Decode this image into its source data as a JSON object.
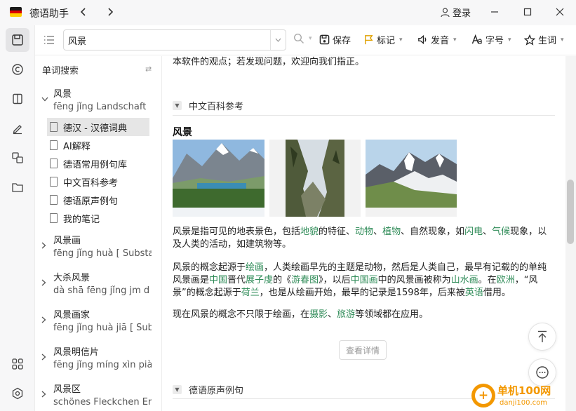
{
  "app": {
    "title": "德语助手",
    "login": "登录"
  },
  "colors": {
    "accent": "#2e8b57",
    "watermark": "#f39800",
    "flag_black": "#1a1a1a",
    "flag_red": "#dd0000",
    "flag_gold": "#ffce00"
  },
  "toolbar": {
    "search_value": "风景",
    "save": "保存",
    "bookmark": "标记",
    "pronounce": "发音",
    "font": "字号",
    "newword": "生词"
  },
  "sidebar": {
    "header": "单词搜索",
    "entries": [
      {
        "word": "风景",
        "pinyin": "fēng jǐng    Landschaft"
      },
      {
        "word": "风景画",
        "pinyin": "fēng jǐng huà   [ Substa"
      },
      {
        "word": "大杀风景",
        "pinyin": "dà shā fēng jǐng    jm d"
      },
      {
        "word": "风景画家",
        "pinyin": "fēng jǐng huà jiā   [ Sub"
      },
      {
        "word": "风景明信片",
        "pinyin": "fēng jǐng míng xìn piàn"
      },
      {
        "word": "风景区",
        "pinyin": "schönes Fleckchen Erde"
      }
    ],
    "subitems": [
      "德汉 - 汉德词典",
      "AI解释",
      "德语常用例句库",
      "中文百科参考",
      "德语原声例句",
      "我的笔记"
    ]
  },
  "main": {
    "top_text": "本软件的观点；若发现问题，欢迎向我们指正。",
    "section1": "中文百科参考",
    "entry_title": "风景",
    "p1": [
      {
        "t": "风景是指可见的地表景色，包括"
      },
      {
        "t": "地貌",
        "g": 1
      },
      {
        "t": "的特征、"
      },
      {
        "t": "动物",
        "g": 1
      },
      {
        "t": "、"
      },
      {
        "t": "植物",
        "g": 1
      },
      {
        "t": "、自然现象，如"
      },
      {
        "t": "闪电",
        "g": 1
      },
      {
        "t": "、"
      },
      {
        "t": "气候",
        "g": 1
      },
      {
        "t": "现象，以及人类的活动，如建筑物等。"
      }
    ],
    "p2": [
      {
        "t": "风景的概念起源于"
      },
      {
        "t": "绘画",
        "g": 1
      },
      {
        "t": "，人类绘画早先的主题是动物，然后是人类自己，最早有记载的的单纯风景画是"
      },
      {
        "t": "中国",
        "g": 1
      },
      {
        "t": "晋代"
      },
      {
        "t": "展子虔",
        "g": 1
      },
      {
        "t": "的《"
      },
      {
        "t": "游春图",
        "g": 1
      },
      {
        "t": "》，以后"
      },
      {
        "t": "中国画",
        "g": 1
      },
      {
        "t": "中的风景画被称为"
      },
      {
        "t": "山水画",
        "g": 1
      },
      {
        "t": "。在"
      },
      {
        "t": "欧洲",
        "g": 1
      },
      {
        "t": "，“风景”的概念起源于"
      },
      {
        "t": "荷兰",
        "g": 1
      },
      {
        "t": "，也是从绘画开始，最早的记录是1598年，后来被"
      },
      {
        "t": "英语",
        "g": 1
      },
      {
        "t": "借用。"
      }
    ],
    "p3": [
      {
        "t": "现在风景的概念不只限于绘画，在"
      },
      {
        "t": "摄影",
        "g": 1
      },
      {
        "t": "、"
      },
      {
        "t": "旅游",
        "g": 1
      },
      {
        "t": "等领域都在应用。"
      }
    ],
    "detail_button": "查看详情",
    "section2": "德语原声例句"
  },
  "watermark": {
    "name": "单机100网",
    "url": "danji100.com"
  }
}
